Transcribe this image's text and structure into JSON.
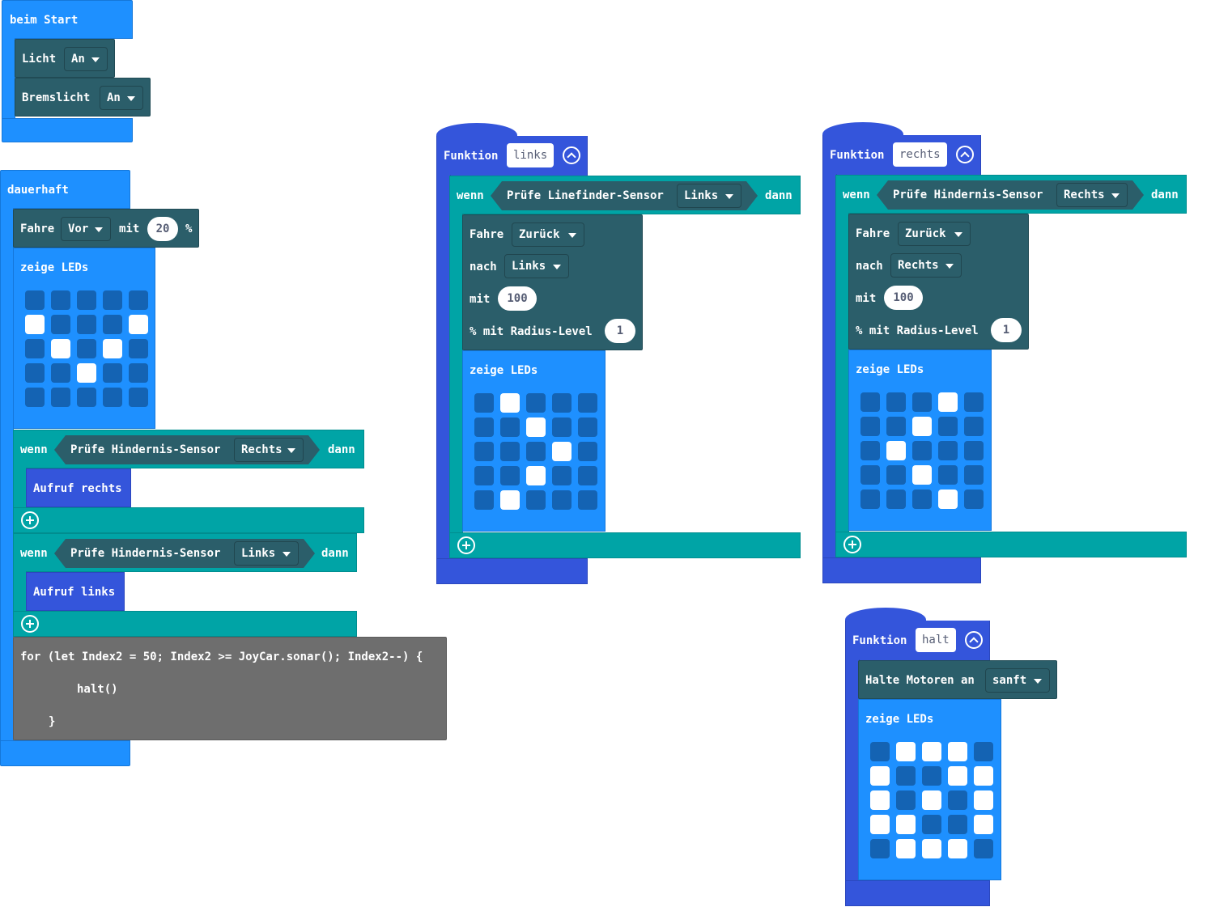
{
  "beim_start": {
    "label": "beim Start",
    "licht": {
      "label": "Licht",
      "value": "An"
    },
    "bremslicht": {
      "label": "Bremslicht",
      "value": "An"
    }
  },
  "dauerhaft": {
    "label": "dauerhaft",
    "fahre": {
      "label": "Fahre",
      "direction": "Vor",
      "mit": "mit",
      "speed": "20",
      "unit": "%"
    },
    "zeige_leds": {
      "label": "zeige LEDs",
      "grid": [
        [
          0,
          0,
          0,
          0,
          0
        ],
        [
          1,
          0,
          0,
          0,
          1
        ],
        [
          0,
          1,
          0,
          1,
          0
        ],
        [
          0,
          0,
          1,
          0,
          0
        ],
        [
          0,
          0,
          0,
          0,
          0
        ]
      ]
    },
    "if1": {
      "wenn": "wenn",
      "check": "Prüfe Hindernis-Sensor",
      "side": "Rechts",
      "dann": "dann",
      "call": "Aufruf rechts"
    },
    "if2": {
      "wenn": "wenn",
      "check": "Prüfe Hindernis-Sensor",
      "side": "Links",
      "dann": "dann",
      "call": "Aufruf links"
    },
    "code": {
      "line1": "for (let Index2 = 50; Index2 >= JoyCar.sonar(); Index2--) {",
      "line2": "halt()",
      "line3": "}"
    }
  },
  "func_links": {
    "label": "Funktion",
    "name": "links",
    "wenn": "wenn",
    "check": "Prüfe Linefinder-Sensor",
    "side": "Links",
    "dann": "dann",
    "fahre": "Fahre",
    "direction": "Zurück",
    "nach": "nach",
    "nach_value": "Links",
    "mit": "mit",
    "speed": "100",
    "radius_label": "% mit Radius-Level",
    "radius": "1",
    "zeige": "zeige LEDs",
    "grid": [
      [
        0,
        1,
        0,
        0,
        0
      ],
      [
        0,
        0,
        1,
        0,
        0
      ],
      [
        0,
        0,
        0,
        1,
        0
      ],
      [
        0,
        0,
        1,
        0,
        0
      ],
      [
        0,
        1,
        0,
        0,
        0
      ]
    ]
  },
  "func_rechts": {
    "label": "Funktion",
    "name": "rechts",
    "wenn": "wenn",
    "check": "Prüfe Hindernis-Sensor",
    "side": "Rechts",
    "dann": "dann",
    "fahre": "Fahre",
    "direction": "Zurück",
    "nach": "nach",
    "nach_value": "Rechts",
    "mit": "mit",
    "speed": "100",
    "radius_label": "% mit Radius-Level",
    "radius": "1",
    "zeige": "zeige LEDs",
    "grid": [
      [
        0,
        0,
        0,
        1,
        0
      ],
      [
        0,
        0,
        1,
        0,
        0
      ],
      [
        0,
        1,
        0,
        0,
        0
      ],
      [
        0,
        0,
        1,
        0,
        0
      ],
      [
        0,
        0,
        0,
        1,
        0
      ]
    ]
  },
  "func_halt": {
    "label": "Funktion",
    "name": "halt",
    "halte": "Halte Motoren an",
    "mode": "sanft",
    "zeige": "zeige LEDs",
    "grid": [
      [
        0,
        1,
        1,
        1,
        0
      ],
      [
        1,
        0,
        0,
        1,
        1
      ],
      [
        1,
        0,
        1,
        0,
        1
      ],
      [
        1,
        1,
        0,
        0,
        1
      ],
      [
        0,
        1,
        1,
        1,
        0
      ]
    ]
  },
  "colors": {
    "event": "#1e90ff",
    "dark": "#2b5e6a",
    "teal": "#00a4a6",
    "function": "#3455db",
    "led_off": "#1463b3",
    "led_on": "#ffffff",
    "code": "#6e6e6e"
  }
}
